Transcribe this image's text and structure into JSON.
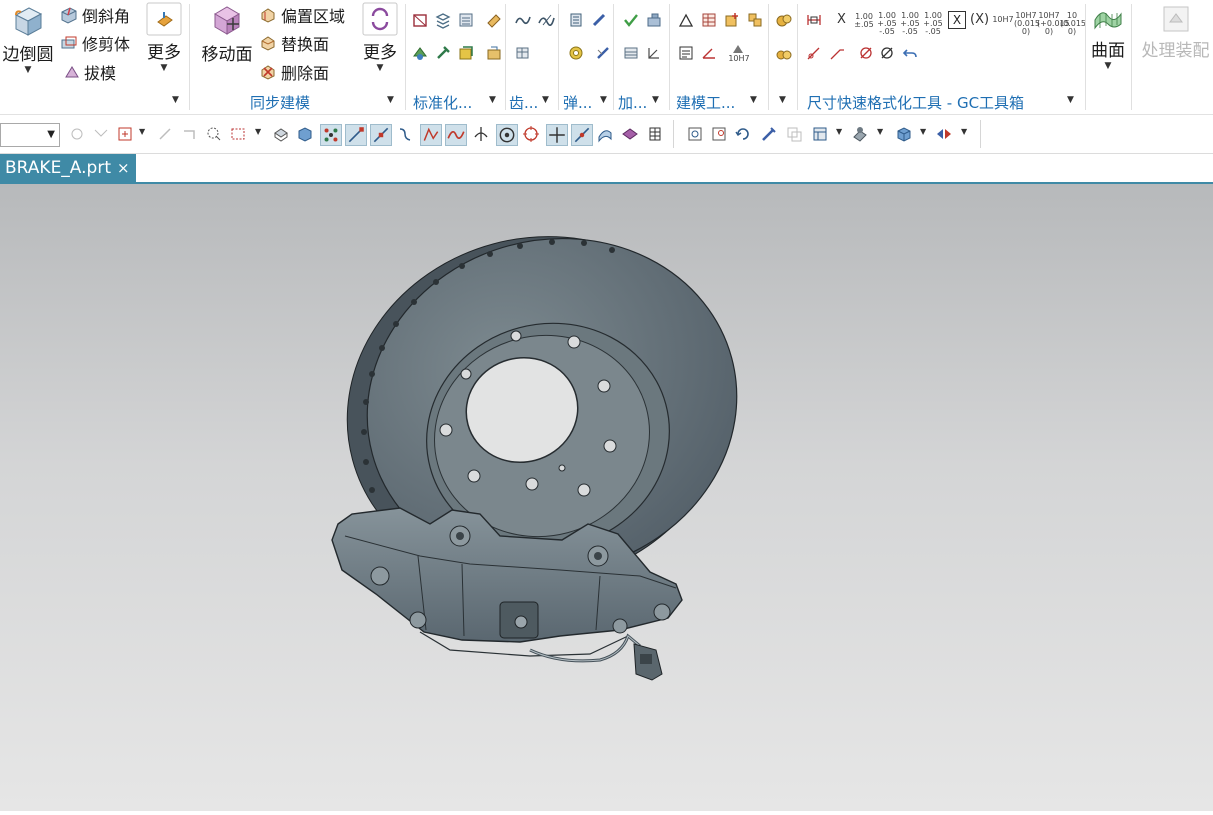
{
  "ribbon": {
    "feature_group": {
      "edge_blend": "边倒圆",
      "chamfer": "倒斜角",
      "trim_body": "修剪体",
      "draft": "拔模",
      "more": "更多"
    },
    "sync_group": {
      "move_face": "移动面",
      "offset_region": "偏置区域",
      "replace_face": "替换面",
      "delete_face": "删除面",
      "more": "更多",
      "label": "同步建模"
    },
    "group_labels": {
      "standardization": "标准化...",
      "gear": "齿...",
      "spring": "弹...",
      "machining": "加...",
      "modeling_tools": "建模工...",
      "dimension_tools": "尺寸快速格式化工具 - GC工具箱"
    },
    "dimension_samples": [
      "1.00 ±.05",
      "1.00 +.05 -.05",
      "1.00 +.05 -.05",
      "1.00 +.05 -.05",
      "10H7",
      "10H7 (0.015 0)",
      "10H7 (+0.015 0)",
      "10 (0.015 0)"
    ],
    "dim_x_label": "X",
    "dim_boxed_x": "X",
    "dim_paren_x": "(X)",
    "gear_tool_label": "10H7",
    "surface": "曲面",
    "process_assembly": "处理装配"
  },
  "document_tab": {
    "title": "BRAKE_A.prt",
    "close": "×"
  },
  "colors": {
    "accent": "#3f8aa6",
    "group_label": "#1f6fb3",
    "model_gray": "#6d7a80"
  }
}
